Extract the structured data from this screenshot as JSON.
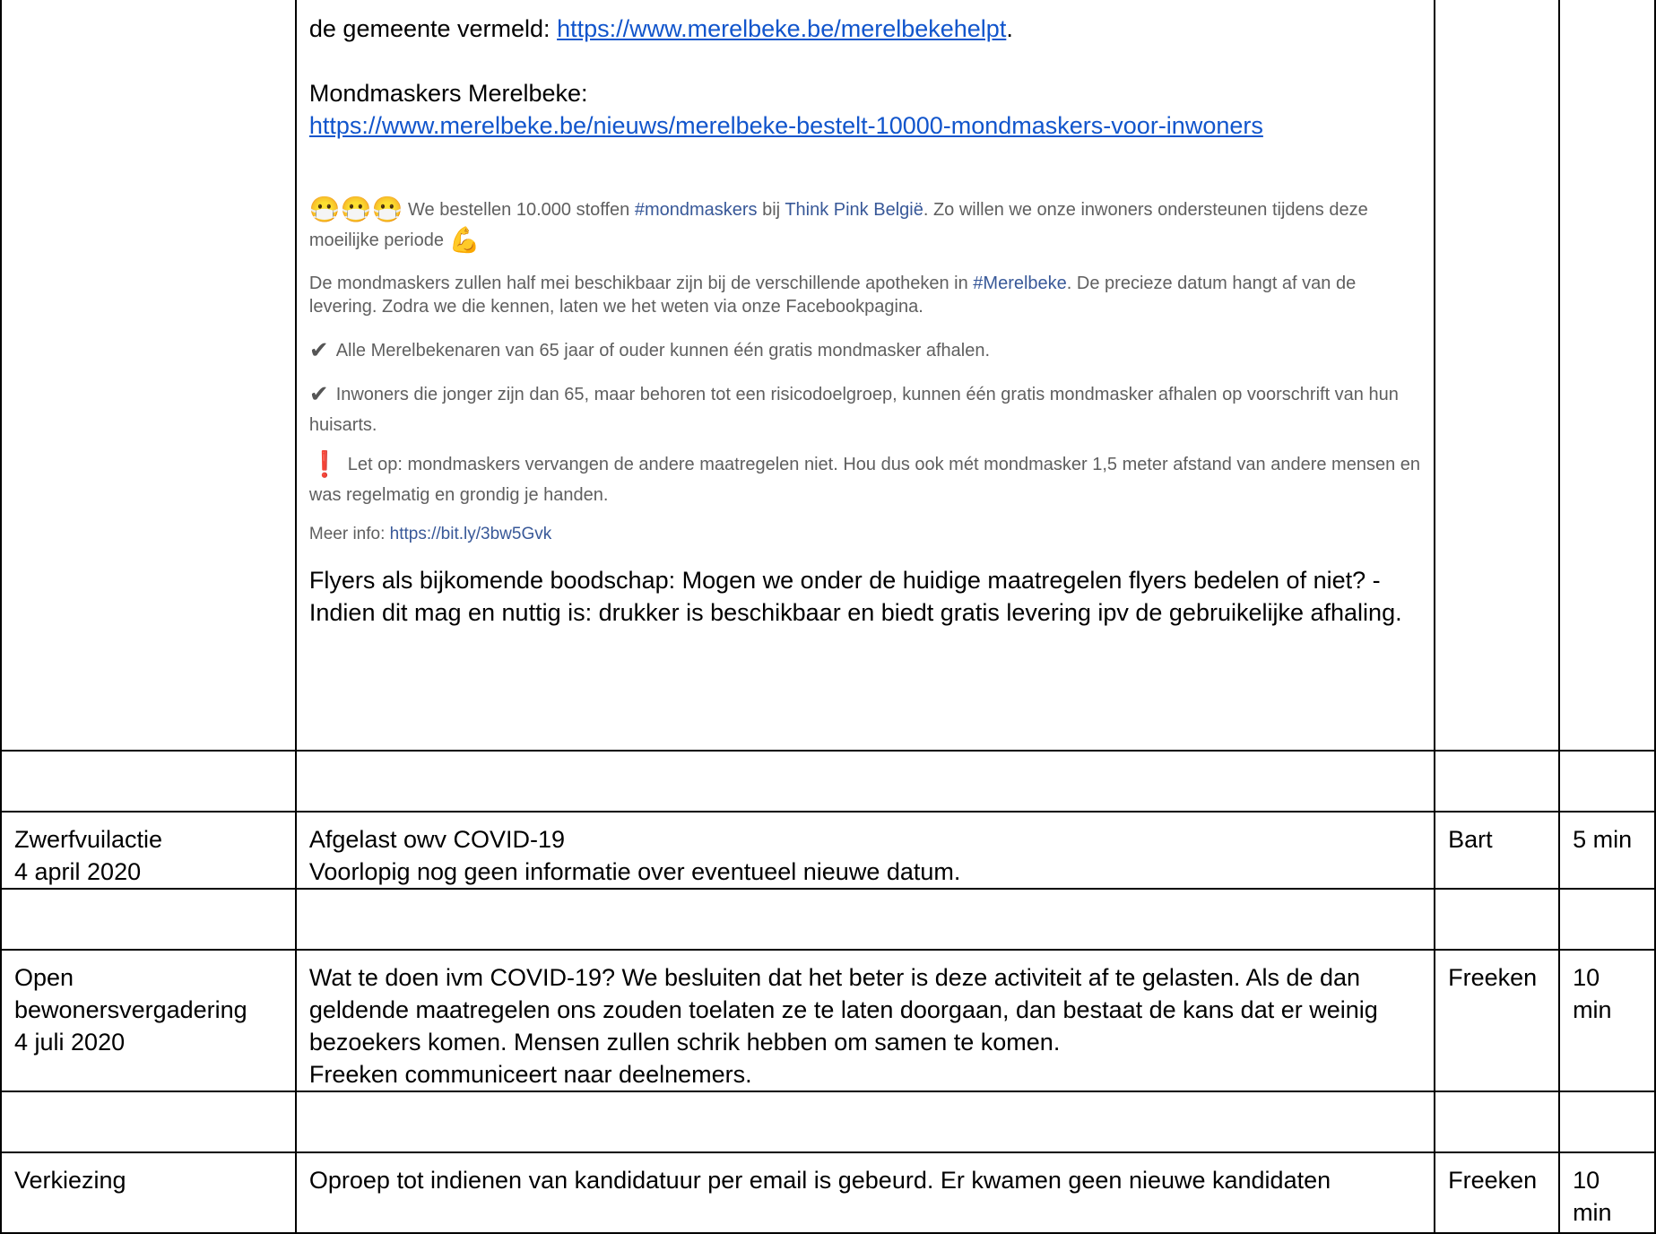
{
  "top_row": {
    "line1_prefix": "de gemeente vermeld: ",
    "line1_link": "https://www.merelbeke.be/merelbekehelpt",
    "line1_suffix": ".",
    "masks_heading": "Mondmaskers Merelbeke:",
    "masks_link": "https://www.merelbeke.be/nieuws/merelbeke-bestelt-10000-mondmaskers-voor-inwoners",
    "fb_post": {
      "mask_emojis": "😷😷😷",
      "p1_a": " We bestellen 10.000 stoffen ",
      "p1_tag": "#mondmaskers",
      "p1_b": " bij ",
      "p1_page": "Think Pink België",
      "p1_c": ". Zo willen we onze inwoners ondersteunen tijdens deze moeilijke periode ",
      "muscle_emoji": "💪",
      "p2_a": "De mondmaskers zullen half mei beschikbaar zijn bij de verschillende apotheken in ",
      "p2_tag": "#Merelbeke",
      "p2_b": ". De precieze datum hangt af van de levering. Zodra we die kennen, laten we het weten via onze Facebookpagina.",
      "check_symbol": "✔",
      "p3": "Alle Merelbekenaren van 65 jaar of ouder kunnen één gratis mondmasker afhalen.",
      "p4": "Inwoners die jonger zijn dan 65, maar behoren tot een risicodoelgroep, kunnen één gratis mondmasker afhalen op voorschrift van hun huisarts.",
      "excl_symbol": "❗",
      "p5": "Let op: mondmaskers vervangen de andere maatregelen niet. Hou dus ook mét mondmasker 1,5 meter afstand van andere mensen en was regelmatig en grondig je handen.",
      "more_info_label": "Meer info: ",
      "more_info_link": "https://bit.ly/3bw5Gvk"
    },
    "flyers": "Flyers als bijkomende boodschap: Mogen we onder de huidige maatregelen flyers bedelen of niet? - Indien dit mag en nuttig is: drukker is beschikbaar en biedt gratis levering ipv de gebruikelijke afhaling."
  },
  "rows": [
    {
      "topic_line1": "Zwerfvuilactie",
      "topic_line2": "4 april 2020",
      "content_line1": "Afgelast owv COVID-19",
      "content_line2": "Voorlopig nog geen informatie over eventueel nieuwe datum.",
      "owner": "Bart",
      "duration": "5 min"
    },
    {
      "topic_line1": "Open bewonersvergadering",
      "topic_line2": "4 juli 2020",
      "content_line1": "Wat te doen ivm COVID-19? We besluiten dat het beter is deze activiteit af te gelasten. Als de dan geldende maatregelen ons zouden toelaten ze te laten doorgaan, dan bestaat de kans dat er weinig bezoekers komen. Mensen zullen schrik hebben om samen te komen.",
      "content_line2": "Freeken communiceert naar deelnemers.",
      "owner": "Freeken",
      "duration": "10 min"
    },
    {
      "topic_line1": "Verkiezing",
      "content_line1": "Oproep tot indienen van kandidatuur per email is gebeurd. Er kwamen geen nieuwe kandidaten",
      "owner": "Freeken",
      "duration": "10 min"
    }
  ]
}
